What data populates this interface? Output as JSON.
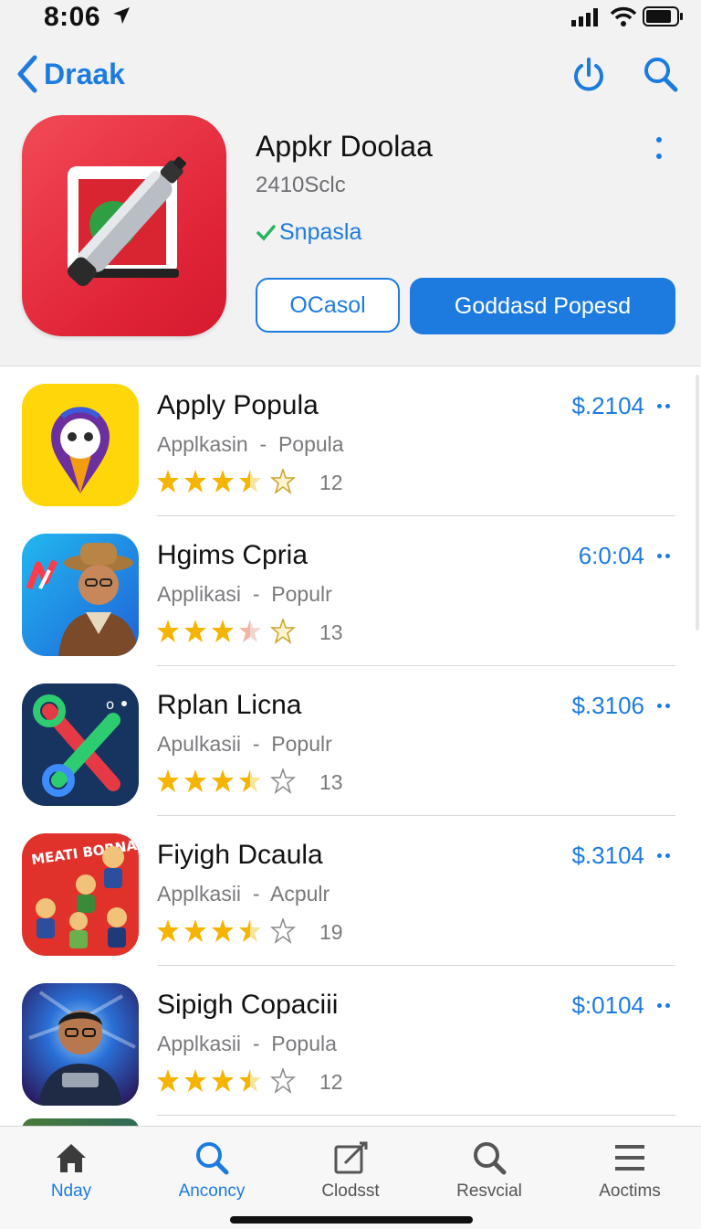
{
  "status": {
    "time": "8:06"
  },
  "nav": {
    "back_label": "Draak"
  },
  "hero": {
    "title": "Appkr Doolaa",
    "subtitle": "2410Sclc",
    "verified": "Snpasla",
    "btn_secondary": "OCasol",
    "btn_primary": "Goddasd Popesd"
  },
  "apps": [
    {
      "name": "Apply Popula",
      "category": "Applkasin",
      "subcategory": "Popula",
      "rating": 3.5,
      "count": "12",
      "price": "$.2104"
    },
    {
      "name": "Hgims Cpria",
      "category": "Applikasi",
      "subcategory": "Populr",
      "rating": 3.5,
      "count": "13",
      "price": "6:0:04"
    },
    {
      "name": "Rplan Licna",
      "category": "Apulkasii",
      "subcategory": "Populr",
      "rating": 3.5,
      "count": "13",
      "price": "$.3106"
    },
    {
      "name": "Fiyigh Dcaula",
      "category": "Applkasii",
      "subcategory": "Acpulr",
      "rating": 3.5,
      "count": "19",
      "price": "$.3104"
    },
    {
      "name": "Sipigh Copaciii",
      "category": "Applkasii",
      "subcategory": "Popula",
      "rating": 3.5,
      "count": "12",
      "price": "$:0104"
    }
  ],
  "app_icon_text": {
    "app4_banner": "MEATI BORNAR"
  },
  "tabs": [
    {
      "label": "Nday",
      "icon": "home-icon",
      "active": false
    },
    {
      "label": "Anconcy",
      "icon": "search-icon",
      "active": true
    },
    {
      "label": "Clodsst",
      "icon": "compose-icon",
      "active": false
    },
    {
      "label": "Resvcial",
      "icon": "search-icon",
      "active": false
    },
    {
      "label": "Aoctims",
      "icon": "menu-icon",
      "active": false
    }
  ],
  "colors": {
    "accent": "#1d7be0",
    "star": "#f5b400",
    "hero_bg": "#e02336"
  }
}
